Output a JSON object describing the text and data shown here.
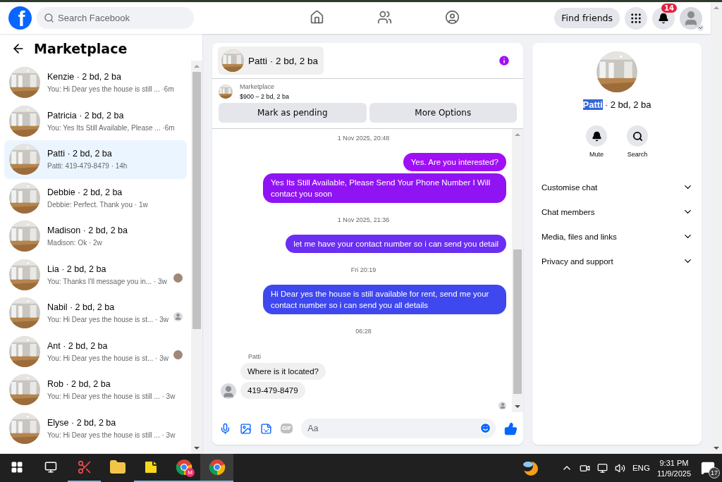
{
  "topbar": {
    "logo": "f",
    "search": {
      "placeholder": "Search Facebook"
    },
    "nav": [
      {
        "kind": "home",
        "selected": false
      },
      {
        "kind": "friends",
        "selected": false
      },
      {
        "kind": "groups",
        "selected": false
      }
    ],
    "find_friends": "Find friends",
    "notification_count": "14"
  },
  "sidebar": {
    "title": "Marketplace",
    "conversations": [
      {
        "name": "Kenzie · 2 bd, 2 ba",
        "preview": "You: Hi Dear yes the house is still ...",
        "time": "·6m",
        "selected": false
      },
      {
        "name": "Patricia · 2 bd, 2 ba",
        "preview": "You: Yes Its Still Available, Please ...",
        "time": "·6m",
        "selected": false
      },
      {
        "name": "Patti · 2 bd, 2 ba",
        "preview": "Patti: 419-479-8479",
        "time": "· 14h",
        "selected": true
      },
      {
        "name": "Debbie · 2 bd, 2 ba",
        "preview": "Debbie: Perfect. Thank you",
        "time": "· 1w",
        "selected": false
      },
      {
        "name": "Madison · 2 bd, 2 ba",
        "preview": "Madison: Ok",
        "time": "· 2w",
        "selected": false
      },
      {
        "name": "Lia · 2 bd, 2 ba",
        "preview": "You: Thanks I'll message you in...",
        "time": "· 3w",
        "selected": false
      },
      {
        "name": "Nabil · 2 bd, 2 ba",
        "preview": "You: Hi Dear yes the house is st...",
        "time": "· 3w",
        "selected": false,
        "read_receipt": {
          "kind": "silhouette"
        }
      },
      {
        "name": "Ant · 2 bd, 2 ba",
        "preview": "You: Hi Dear yes the house is st...",
        "time": "· 3w",
        "selected": false
      },
      {
        "name": "Rob · 2 bd, 2 ba",
        "preview": "You: Hi Dear yes the house is still ...",
        "time": "· 3w",
        "selected": false
      },
      {
        "name": "Elyse · 2 bd, 2 ba",
        "preview": "You: Hi Dear yes the house is still ...",
        "time": "· 3w",
        "selected": false
      }
    ]
  },
  "chat": {
    "title": "Patti · 2 bd, 2 ba",
    "listing": {
      "source": "Marketplace",
      "summary": "$900 – 2 bd, 2 ba"
    },
    "buttons": [
      "Mark as pending",
      "More Options"
    ],
    "messages": [
      {
        "kind": "timestamp",
        "text": "1 Nov 2025, 20:48"
      },
      {
        "kind": "outgoing",
        "text": "Yes. Are you interested?",
        "color": "#a10ff6"
      },
      {
        "kind": "outgoing",
        "text": "Yes Its Still Available, Please Send Your Phone Number I Will contact you soon",
        "color": "#9014f3"
      },
      {
        "kind": "timestamp",
        "text": "1 Nov 2025, 21:36"
      },
      {
        "kind": "outgoing",
        "text": "let me have your contact number so i can send you detail",
        "color": "#6a2ff2"
      },
      {
        "kind": "timestamp",
        "text": "Fri 20:19"
      },
      {
        "kind": "outgoing",
        "text": "Hi Dear yes the house is still available for rent, send me your contact number so i can send you all details",
        "color": "#3f47ef"
      },
      {
        "kind": "timestamp",
        "text": "06:28"
      },
      {
        "kind": "sender",
        "text": "Patti"
      },
      {
        "kind": "incoming",
        "text": "Where is it located?",
        "avatar": false
      },
      {
        "kind": "incoming",
        "text": "419-479-8479",
        "avatar": true
      }
    ],
    "composer": {
      "placeholder": "Aa",
      "gif_label": "GIF"
    }
  },
  "details": {
    "name": "Patti",
    "name_highlighted": true,
    "subtitle": "· 2 bd, 2 ba",
    "actions": [
      {
        "kind": "mute",
        "label": "Mute"
      },
      {
        "kind": "search",
        "label": "Search"
      }
    ],
    "sections": [
      {
        "label": "Customise chat",
        "expanded": false
      },
      {
        "label": "Chat members",
        "expanded": false
      },
      {
        "label": "Media, files and links",
        "expanded": false
      },
      {
        "label": "Privacy and support",
        "expanded": false
      }
    ]
  },
  "taskbar": {
    "apps": [
      {
        "kind": "snip",
        "running": true,
        "selected": false
      },
      {
        "kind": "explorer",
        "running": false,
        "selected": false
      },
      {
        "kind": "sticky",
        "running": true,
        "selected": false
      },
      {
        "kind": "chrome",
        "running": true,
        "selected": false,
        "badge": "M"
      },
      {
        "kind": "chrome",
        "running": true,
        "selected": true
      }
    ],
    "language": "ENG",
    "time": "9:31 PM",
    "date": "11/9/2025",
    "notification_count": "17"
  }
}
